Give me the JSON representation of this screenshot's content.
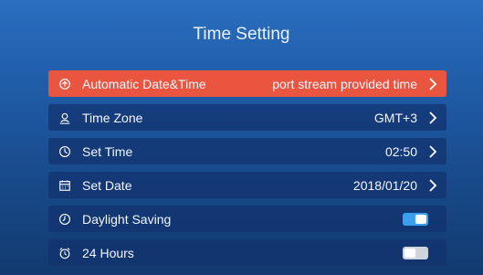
{
  "title": "Time Setting",
  "rows": [
    {
      "label": "Automatic Date&Time",
      "value": "port stream provided time",
      "icon": "auto-time-icon",
      "active": true
    },
    {
      "label": "Time Zone",
      "value": "GMT+3",
      "icon": "globe-pin-icon"
    },
    {
      "label": "Set Time",
      "value": "02:50",
      "icon": "clock-icon"
    },
    {
      "label": "Set Date",
      "value": "2018/01/20",
      "icon": "calendar-icon"
    },
    {
      "label": "Daylight Saving",
      "toggle": "on",
      "icon": "daylight-clock-icon"
    },
    {
      "label": "24 Hours",
      "toggle": "off",
      "icon": "alarm-clock-icon"
    }
  ],
  "colors": {
    "active": "#e9553f",
    "toggle_on": "#3aa0f0",
    "toggle_off": "#cfd5de"
  }
}
